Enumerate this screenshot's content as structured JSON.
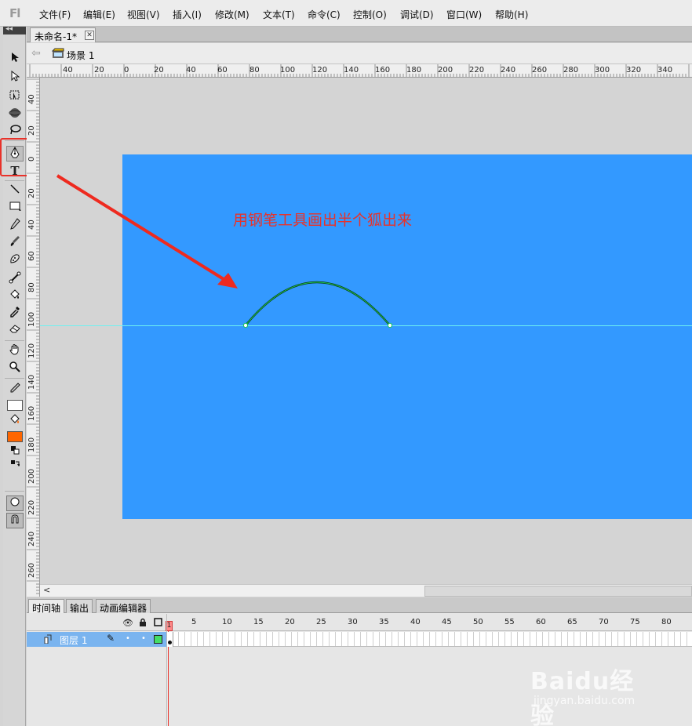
{
  "app": {
    "logo": "Fl"
  },
  "menu": [
    "文件(F)",
    "编辑(E)",
    "视图(V)",
    "插入(I)",
    "修改(M)",
    "文本(T)",
    "命令(C)",
    "控制(O)",
    "调试(D)",
    "窗口(W)",
    "帮助(H)"
  ],
  "document": {
    "tab_title": "未命名-1*",
    "close_glyph": "✕"
  },
  "breadcrumb": {
    "scene": "场景 1"
  },
  "ruler_top": [
    "40",
    "20",
    "0",
    "20",
    "40",
    "60",
    "80",
    "100",
    "120",
    "140",
    "160",
    "180",
    "200",
    "220",
    "240",
    "260",
    "280",
    "300",
    "320",
    "340"
  ],
  "ruler_left": [
    "40",
    "20",
    "0",
    "20",
    "40",
    "60",
    "80",
    "100",
    "120",
    "140",
    "160",
    "180",
    "200",
    "220",
    "240",
    "260"
  ],
  "stage": {
    "color": "#3399ff",
    "annotation": "用钢笔工具画出半个狐出来",
    "annotation_color": "#e8322a"
  },
  "tools": {
    "selection": "selection-arrow-icon",
    "subselection": "subselection-arrow-icon",
    "free_transform": "free-transform-icon",
    "3d_rotation": "3d-rotation-icon",
    "lasso": "lasso-icon",
    "pen": "pen-tool-icon",
    "text": "T",
    "line": "line-tool-icon",
    "rectangle": "rectangle-tool-icon",
    "pencil": "pencil-tool-icon",
    "brush": "brush-tool-icon",
    "deco": "deco-tool-icon",
    "bone": "bone-tool-icon",
    "paint_bucket": "paint-bucket-icon",
    "eyedropper": "eyedropper-icon",
    "eraser": "eraser-icon",
    "hand": "hand-tool-icon",
    "zoom": "zoom-tool-icon",
    "stroke_color": "#ffffff",
    "fill_color": "#ff6600"
  },
  "timeline": {
    "tabs": [
      "时间轴",
      "输出",
      "动画编辑器"
    ],
    "frame_numbers": [
      "1",
      "5",
      "10",
      "15",
      "20",
      "25",
      "30",
      "35",
      "40",
      "45",
      "50",
      "55",
      "60",
      "65",
      "70",
      "75",
      "80"
    ],
    "layer_name": "图层 1",
    "header_icons": [
      "eye-icon",
      "lock-icon",
      "outline-icon"
    ]
  },
  "watermark": {
    "brand": "Baidu经验",
    "url": "jingyan.baidu.com"
  }
}
